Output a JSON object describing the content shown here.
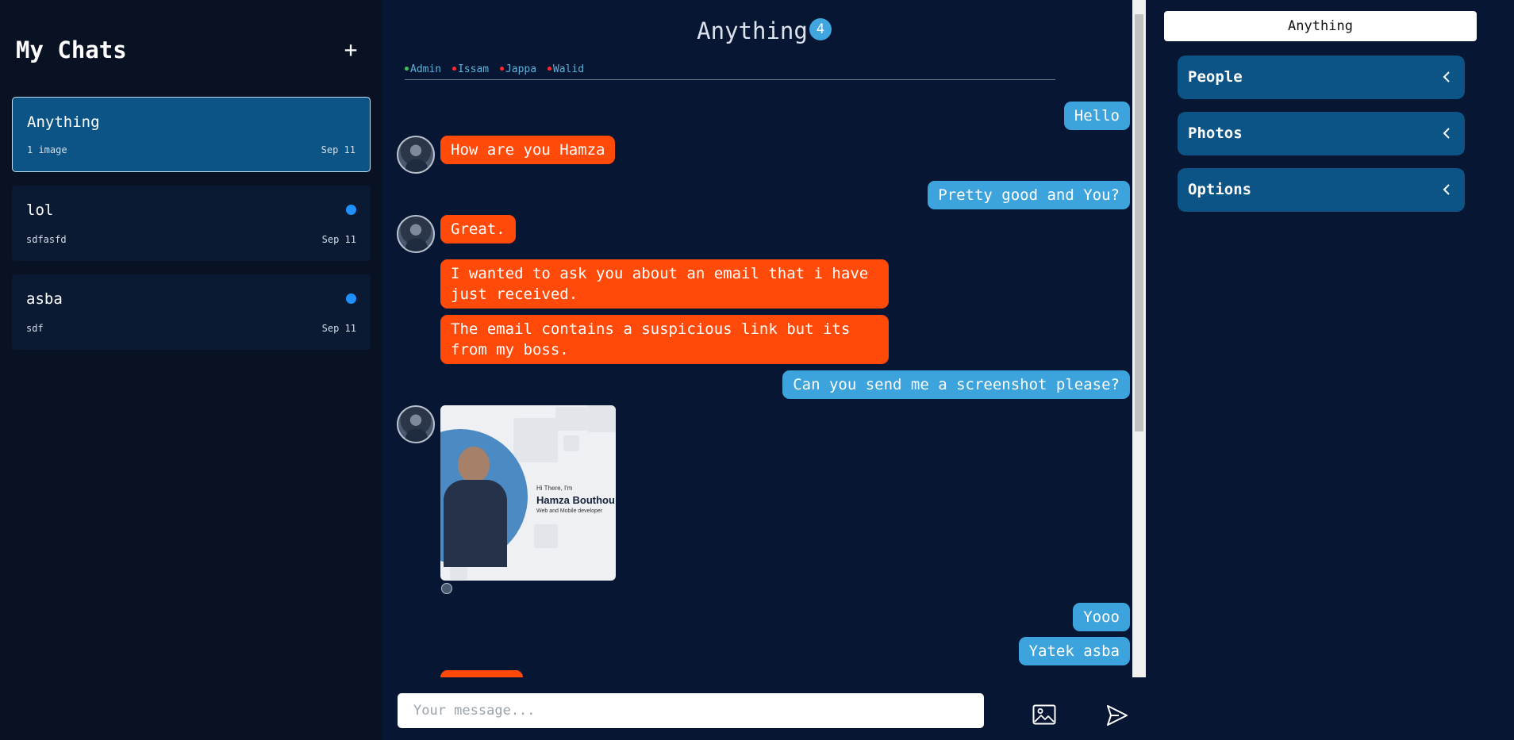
{
  "sidebar": {
    "title": "My Chats",
    "add_icon": "plus-icon",
    "chats": [
      {
        "name": "Anything",
        "subtitle": "1 image",
        "date": "Sep 11",
        "active": true,
        "unread": false
      },
      {
        "name": "lol",
        "subtitle": "sdfasfd",
        "date": "Sep 11",
        "active": false,
        "unread": true
      },
      {
        "name": "asba",
        "subtitle": "sdf",
        "date": "Sep 11",
        "active": false,
        "unread": true
      }
    ]
  },
  "main": {
    "title": "Anything",
    "member_count": "4",
    "members": [
      {
        "name": "Admin",
        "status_color": "#3fbf5f"
      },
      {
        "name": "Issam",
        "status_color": "#ff2a2a"
      },
      {
        "name": "Jappa",
        "status_color": "#ff2a2a"
      },
      {
        "name": "Walid",
        "status_color": "#ff2a2a"
      }
    ],
    "messages": [
      {
        "from": "me",
        "text": "Hello"
      },
      {
        "from": "other",
        "text": "How are you Hamza"
      },
      {
        "from": "me",
        "text": "Pretty good and You?"
      },
      {
        "from": "other",
        "text": "Great."
      },
      {
        "from": "other",
        "text": "I wanted to ask you about an email that i have\njust received."
      },
      {
        "from": "other",
        "text": "The email contains a suspicious link but its\nfrom my boss."
      },
      {
        "from": "me",
        "text": "Can you send me a screenshot please?"
      },
      {
        "from": "other",
        "type": "image",
        "caption_lines": [
          "Hi There, I'm",
          "Hamza Bouthou",
          "Web and Mobile developer"
        ]
      },
      {
        "from": "me",
        "text": "Yooo"
      },
      {
        "from": "me",
        "text": "Yatek asba"
      }
    ],
    "composer_placeholder": "Your message...",
    "image_icon": "image-icon",
    "send_icon": "send-icon"
  },
  "right_panel": {
    "title": "Anything",
    "sections": [
      {
        "label": "People",
        "icon": "chevron-left-icon"
      },
      {
        "label": "Photos",
        "icon": "chevron-left-icon"
      },
      {
        "label": "Options",
        "icon": "chevron-left-icon"
      }
    ]
  },
  "colors": {
    "accent_blue": "#3da3dd",
    "incoming_orange": "#ff4a0a",
    "panel_blue": "#0c5486",
    "background": "#071633"
  }
}
